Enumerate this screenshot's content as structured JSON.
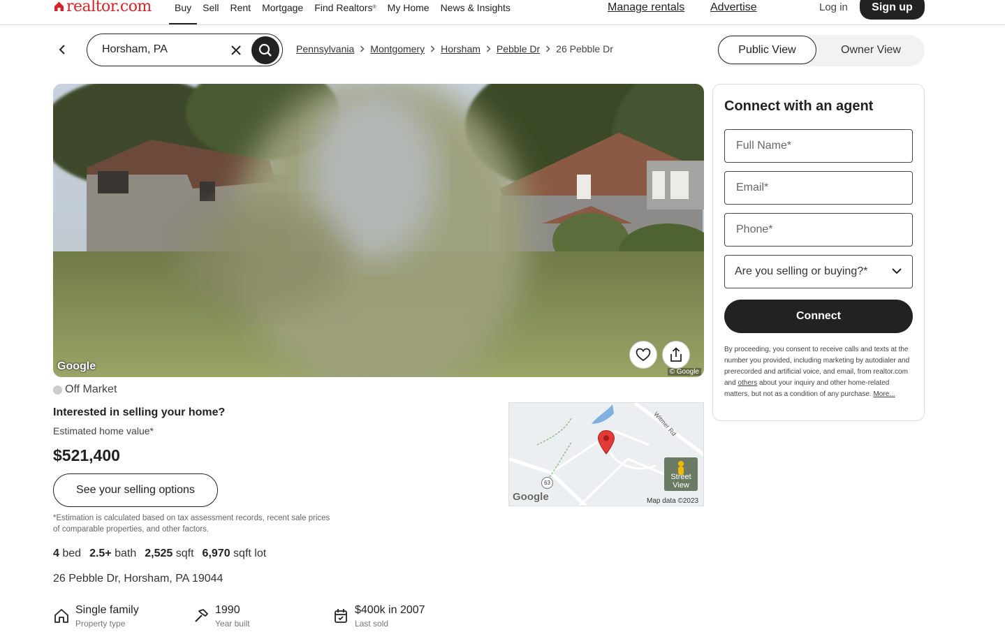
{
  "brand": {
    "logo_text": "realtor.com",
    "brand_color": "#d92228"
  },
  "nav": {
    "links": [
      "Buy",
      "Sell",
      "Rent",
      "Mortgage",
      "Find Realtors",
      "My Home",
      "News & Insights"
    ],
    "find_realtors_mark": "®",
    "active": "Buy",
    "manage_rentals": "Manage rentals",
    "advertise": "Advertise",
    "login": "Log in",
    "signup": "Sign up"
  },
  "search": {
    "value": "Horsham, PA"
  },
  "breadcrumb": {
    "links": [
      "Pennsylvania",
      "Montgomery",
      "Horsham",
      "Pebble Dr"
    ],
    "current": "26 Pebble Dr"
  },
  "view_toggle": {
    "public": "Public View",
    "owner": "Owner View",
    "selected": "Public View"
  },
  "photo": {
    "watermark": "Google",
    "copyright": "© Google"
  },
  "listing": {
    "status": "Off Market",
    "sell_question": "Interested in selling your home?",
    "estimate_label": "Estimated home value*",
    "estimate_value": "$521,400",
    "sell_button": "See your selling options",
    "estimate_note": "*Estimation is calculated based on tax assessment records, recent sale prices of comparable properties, and other factors.",
    "facts": [
      {
        "value": "4",
        "unit": "bed"
      },
      {
        "value": "2.5+",
        "unit": "bath"
      },
      {
        "value": "2,525",
        "unit": "sqft"
      },
      {
        "value": "6,970",
        "unit": "sqft lot"
      }
    ],
    "address": "26 Pebble Dr, Horsham, PA 19044",
    "details": [
      {
        "icon": "house-icon",
        "value": "Single family",
        "label": "Property type"
      },
      {
        "icon": "hammer-icon",
        "value": "1990",
        "label": "Year built"
      },
      {
        "icon": "calendar-icon",
        "value": "$400k in 2007",
        "label": "Last sold"
      }
    ]
  },
  "map": {
    "road_label": "Witmer Rd",
    "route_shield": "63",
    "watermark": "Google",
    "attribution": "Map data ©2023",
    "street_view_line1": "Street",
    "street_view_line2": "View",
    "pin_color": "#e53935"
  },
  "agent_form": {
    "title": "Connect with an agent",
    "full_name_placeholder": "Full Name*",
    "email_placeholder": "Email*",
    "phone_placeholder": "Phone*",
    "select_label": "Are you selling or buying?*",
    "connect_button": "Connect",
    "consent_text_1": "By proceeding, you consent to receive calls and texts at the number you provided, including marketing by autodialer and prerecorded and artificial voice, and email, from realtor.com and ",
    "consent_link_others": "others",
    "consent_text_2": " about your inquiry and other home-related matters, but not as a condition of any purchase. ",
    "consent_link_more": "More..."
  }
}
